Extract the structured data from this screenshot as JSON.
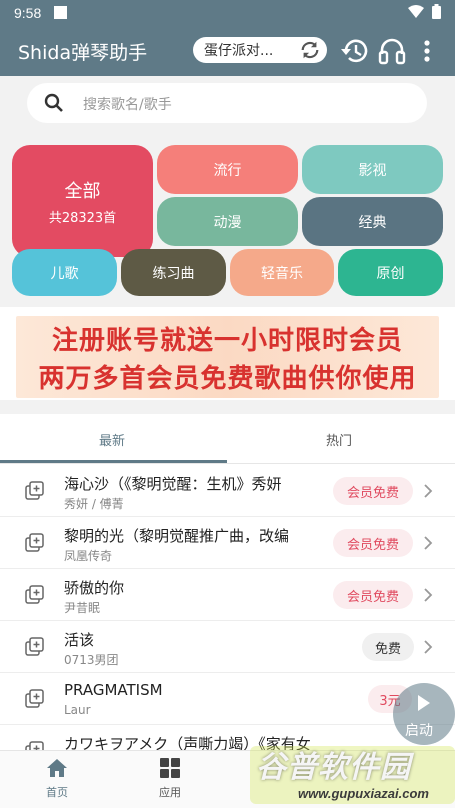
{
  "status_bar": {
    "time": "9:58"
  },
  "app_bar": {
    "title": "Shida弹琴助手",
    "current_song": "蛋仔派对...",
    "icons": [
      "refresh-icon",
      "history-icon",
      "headphones-icon",
      "more-vert-icon"
    ]
  },
  "search": {
    "placeholder": "搜索歌名/歌手"
  },
  "categories": {
    "all": {
      "label": "全部",
      "count": "共28323首",
      "color": "#e34b62"
    },
    "items": [
      {
        "label": "流行",
        "color": "#f57f7a"
      },
      {
        "label": "影视",
        "color": "#7ec9c0"
      },
      {
        "label": "动漫",
        "color": "#78b79d"
      },
      {
        "label": "经典",
        "color": "#5a7482"
      },
      {
        "label": "儿歌",
        "color": "#55c3d9"
      },
      {
        "label": "练习曲",
        "color": "#5e5a45"
      },
      {
        "label": "轻音乐",
        "color": "#f5a98a"
      },
      {
        "label": "原创",
        "color": "#2db591"
      }
    ]
  },
  "banner": {
    "line1": "注册账号就送一小时限时会员",
    "line2": "两万多首会员免费歌曲供你使用"
  },
  "tabs": [
    {
      "label": "最新",
      "active": true
    },
    {
      "label": "热门",
      "active": false
    }
  ],
  "songs": [
    {
      "name": "海心沙（《黎明觉醒：生机》秀妍",
      "artist": "秀妍 / 傅菁",
      "badge": "会员免费",
      "badge_type": "vip"
    },
    {
      "name": "黎明的光（黎明觉醒推广曲，改编",
      "artist": "凤凰传奇",
      "badge": "会员免费",
      "badge_type": "vip"
    },
    {
      "name": "骄傲的你",
      "artist": "尹昔眠",
      "badge": "会员免费",
      "badge_type": "vip"
    },
    {
      "name": "活该",
      "artist": "0713男团",
      "badge": "免费",
      "badge_type": "free"
    },
    {
      "name": "PRAGMATISM",
      "artist": "Laur",
      "badge": "3元",
      "badge_type": "paid"
    },
    {
      "name": "カワキヲアメク（声嘶力竭）《家有女",
      "artist": "",
      "badge": "",
      "badge_type": "none"
    }
  ],
  "fab": {
    "label": "启动"
  },
  "bottom_nav": [
    {
      "label": "首页",
      "icon": "home-icon",
      "active": true
    },
    {
      "label": "应用",
      "icon": "apps-icon",
      "active": false
    }
  ],
  "watermark": {
    "text": "谷普软件园",
    "url": "www.gupuxiazai.com"
  }
}
